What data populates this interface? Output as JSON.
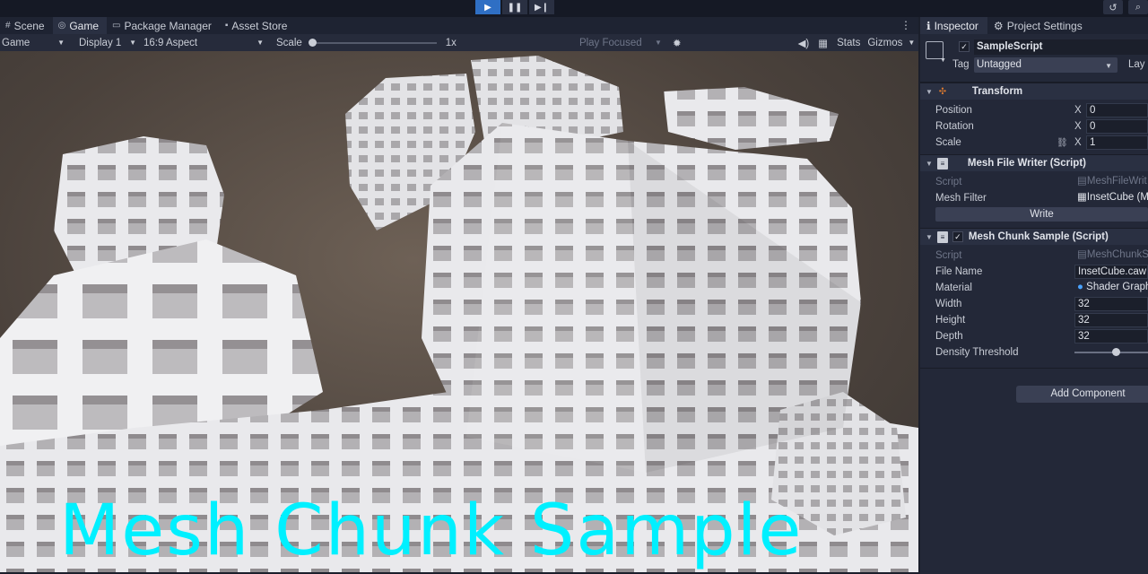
{
  "playbar": {
    "play_icon": "play-icon",
    "pause_icon": "pause-icon",
    "step_icon": "step-icon"
  },
  "left_tabs": [
    {
      "label": "Scene",
      "icon": "hash-icon"
    },
    {
      "label": "Game",
      "icon": "gamepad-icon"
    },
    {
      "label": "Package Manager",
      "icon": "package-icon"
    },
    {
      "label": "Asset Store",
      "icon": "bag-icon"
    }
  ],
  "game_toolbar": {
    "mode": "Game",
    "display": "Display 1",
    "aspect": "16:9 Aspect",
    "scale_label": "Scale",
    "scale_value": "1x",
    "play_focused": "Play Focused",
    "stats": "Stats",
    "gizmos": "Gizmos"
  },
  "viewport": {
    "title": "Mesh Chunk Sample",
    "title_color": "#00f0ff"
  },
  "right_tabs": [
    {
      "label": "Inspector",
      "icon": "info-icon"
    },
    {
      "label": "Project Settings",
      "icon": "gear-icon"
    }
  ],
  "object": {
    "name": "SampleScript",
    "tag_label": "Tag",
    "tag_value": "Untagged",
    "layer_label": "Lay"
  },
  "transform": {
    "title": "Transform",
    "position_label": "Position",
    "position_x": "0",
    "rotation_label": "Rotation",
    "rotation_x": "0",
    "scale_label": "Scale",
    "scale_x": "1",
    "x_label": "X"
  },
  "mesh_file_writer": {
    "title": "Mesh File Writer (Script)",
    "script_label": "Script",
    "script_value": "MeshFileWrit",
    "mesh_filter_label": "Mesh Filter",
    "mesh_filter_value": "InsetCube (M",
    "write_label": "Write"
  },
  "mesh_chunk_sample": {
    "title": "Mesh Chunk Sample (Script)",
    "script_label": "Script",
    "script_value": "MeshChunkS",
    "file_name_label": "File Name",
    "file_name_value": "InsetCube.caw",
    "material_label": "Material",
    "material_value": "Shader Graph",
    "width_label": "Width",
    "width_value": "32",
    "height_label": "Height",
    "height_value": "32",
    "depth_label": "Depth",
    "depth_value": "32",
    "density_label": "Density Threshold",
    "density_level": 0.56
  },
  "add_component_label": "Add Component"
}
